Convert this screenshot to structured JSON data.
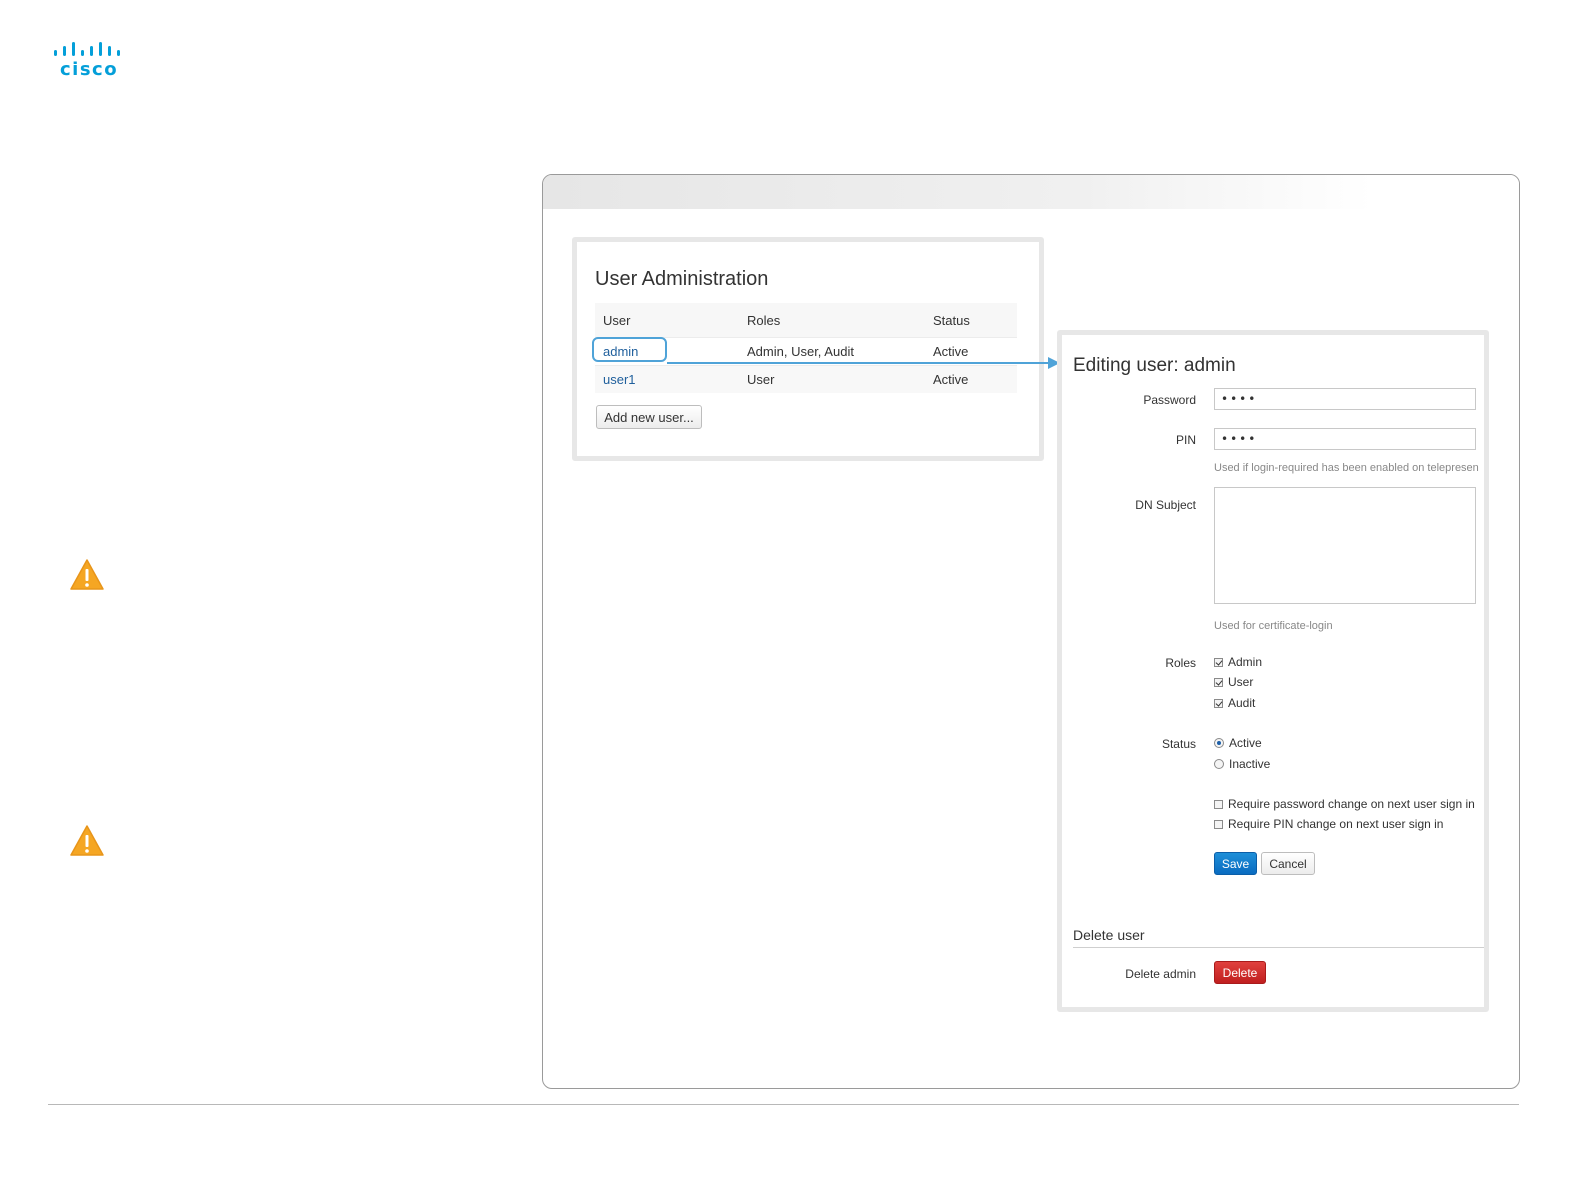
{
  "brand": {
    "name": "cisco",
    "color": "#049fd9"
  },
  "users_panel": {
    "title": "User Administration",
    "columns": [
      "User",
      "Roles",
      "Status"
    ],
    "rows": [
      {
        "user": "admin",
        "roles": "Admin, User, Audit",
        "status": "Active"
      },
      {
        "user": "user1",
        "roles": "User",
        "status": "Active"
      }
    ],
    "add_button": "Add new user..."
  },
  "edit_panel": {
    "title": "Editing user: admin",
    "password_label": "Password",
    "password_value": "••••",
    "pin_label": "PIN",
    "pin_value": "••••",
    "pin_help": "Used if login-required has been enabled on telepresen",
    "dn_label": "DN Subject",
    "dn_help": "Used for certificate-login",
    "roles_label": "Roles",
    "roles": [
      {
        "label": "Admin",
        "checked": true
      },
      {
        "label": "User",
        "checked": true
      },
      {
        "label": "Audit",
        "checked": true
      }
    ],
    "status_label": "Status",
    "status_options": [
      {
        "label": "Active",
        "selected": true
      },
      {
        "label": "Inactive",
        "selected": false
      }
    ],
    "require_password_change": "Require password change on next user sign in",
    "require_pin_change": "Require PIN change on next user sign in",
    "save_button": "Save",
    "cancel_button": "Cancel",
    "delete_section_title": "Delete user",
    "delete_label": "Delete admin",
    "delete_button": "Delete"
  },
  "colors": {
    "link": "#1f5f9c",
    "highlight": "#4fa3d8",
    "save": "#0a6bc0",
    "delete": "#c01f1f",
    "warning": "#f5a623"
  },
  "icons": [
    "cisco-logo",
    "warning-icon",
    "warning-icon",
    "arrow-icon"
  ]
}
